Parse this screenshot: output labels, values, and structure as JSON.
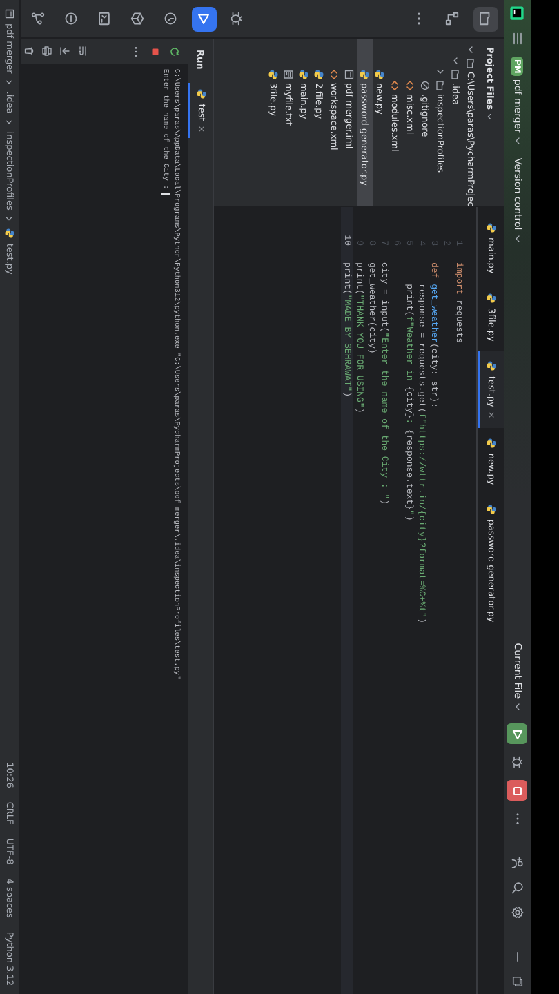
{
  "title_bar": {
    "project_badge": "PM",
    "project": "pdf merger",
    "vcs": "Version control",
    "run_config": "Current File"
  },
  "left_toolbar": [
    {
      "kind": "folder",
      "selected": true
    },
    {
      "kind": "structure",
      "selected": false
    },
    {
      "kind": "more",
      "selected": false
    },
    {
      "kind": "debug",
      "selected": false
    },
    {
      "kind": "run",
      "selected": true
    },
    {
      "kind": "services",
      "selected": false
    },
    {
      "kind": "packages",
      "selected": false
    },
    {
      "kind": "terminal",
      "selected": false
    },
    {
      "kind": "problems",
      "selected": false
    },
    {
      "kind": "git",
      "selected": false
    }
  ],
  "project_panel": {
    "title": "Project Files",
    "tree": [
      {
        "label": "C:\\Users\\paras\\PycharmProjec",
        "kind": "folder",
        "expanded": true,
        "selected": false,
        "children": [
          {
            "label": ".idea",
            "kind": "folder",
            "expanded": true,
            "selected": false,
            "children": [
              {
                "label": "inspectionProfiles",
                "kind": "folder",
                "expanded": false,
                "selected": false
              },
              {
                "label": ".gitignore",
                "kind": "ignore",
                "selected": false
              },
              {
                "label": "misc.xml",
                "kind": "xml",
                "selected": false
              },
              {
                "label": "modules.xml",
                "kind": "xml",
                "selected": false
              }
            ]
          },
          {
            "label": "new.py",
            "kind": "python",
            "selected": false
          },
          {
            "label": "password generator.py",
            "kind": "python",
            "selected": true
          },
          {
            "label": "pdf merger.iml",
            "kind": "module",
            "selected": false
          },
          {
            "label": "workspace.xml",
            "kind": "xml",
            "selected": false
          },
          {
            "label": "2.file.py",
            "kind": "python",
            "selected": false
          },
          {
            "label": "main.py",
            "kind": "python",
            "selected": false
          },
          {
            "label": "myfile.txt",
            "kind": "text",
            "selected": false
          },
          {
            "label": "3file.py",
            "kind": "python",
            "selected": false
          }
        ]
      }
    ]
  },
  "editor": {
    "tabs": [
      {
        "label": "main.py",
        "selected": false
      },
      {
        "label": "3file.py",
        "selected": false
      },
      {
        "label": "test.py",
        "selected": true,
        "close": "×"
      },
      {
        "label": "new.py",
        "selected": false
      },
      {
        "label": "password generator.py",
        "selected": false
      }
    ],
    "lines": [
      {
        "number": "1",
        "current": false,
        "code": [
          {
            "text": "import",
            "kind": "keyword"
          },
          {
            "text": " requests",
            "kind": "plain"
          }
        ]
      },
      {
        "number": "2",
        "current": false
      },
      {
        "number": "3",
        "current": false,
        "code": [
          {
            "text": "def ",
            "kind": "keyword"
          },
          {
            "text": "get_weather",
            "kind": "function"
          },
          {
            "text": "(city: str):",
            "kind": "plain"
          }
        ]
      },
      {
        "number": "4",
        "current": false,
        "code": [
          {
            "text": "    response = requests.get(",
            "kind": "plain"
          },
          {
            "text": "f\"https://wttr.in/{city}?format=%C+%t\"",
            "kind": "string"
          },
          {
            "text": ")",
            "kind": "plain"
          }
        ]
      },
      {
        "number": "5",
        "current": false,
        "code": [
          {
            "text": "    print(",
            "kind": "plain"
          },
          {
            "text": "f\"Weather in ",
            "kind": "string"
          },
          {
            "text": "{city}",
            "kind": "plain"
          },
          {
            "text": ": ",
            "kind": "string"
          },
          {
            "text": "{response.text}",
            "kind": "plain"
          },
          {
            "text": "\"",
            "kind": "string"
          },
          {
            "text": ")",
            "kind": "plain"
          }
        ]
      },
      {
        "number": "6",
        "current": false
      },
      {
        "number": "7",
        "current": false,
        "code": [
          {
            "text": "city = input(",
            "kind": "plain"
          },
          {
            "text": "\"Enter the name of the City : \"",
            "kind": "string"
          },
          {
            "text": ")",
            "kind": "plain"
          }
        ]
      },
      {
        "number": "8",
        "current": false,
        "code": [
          {
            "text": "get_weather(city)",
            "kind": "plain"
          }
        ]
      },
      {
        "number": "9",
        "current": false,
        "code": [
          {
            "text": "print(",
            "kind": "plain"
          },
          {
            "text": "\"THANK YOU FOR USING\"",
            "kind": "string"
          },
          {
            "text": ")",
            "kind": "plain"
          }
        ]
      },
      {
        "number": "10",
        "current": true,
        "code": [
          {
            "text": "print(",
            "kind": "plain"
          },
          {
            "text": "\"MADE BY SEHRAWAT\"",
            "kind": "string"
          },
          {
            "text": ")",
            "kind": "plain"
          }
        ]
      }
    ]
  },
  "run_panel": {
    "title": "Run",
    "tabs": [
      {
        "label": "test",
        "selected": true,
        "close": "×"
      }
    ],
    "output": [
      {
        "text": "C:\\Users\\paras\\AppData\\Local\\Programs\\Python\\Python312\\python.exe \"C:\\Users\\paras\\PycharmProjects\\pdf merger\\.idea\\inspectionProfiles\\test.py\"",
        "kind": "command"
      },
      {
        "text": "Enter the name of the City : ",
        "kind": "prompt"
      }
    ]
  },
  "status_bar": {
    "breadcrumb": [
      "pdf merger",
      ".idea",
      "inspectionProfiles",
      "test.py"
    ],
    "items": [
      "10:26",
      "CRLF",
      "UTF-8",
      "4 spaces",
      "Python 3.12"
    ]
  }
}
